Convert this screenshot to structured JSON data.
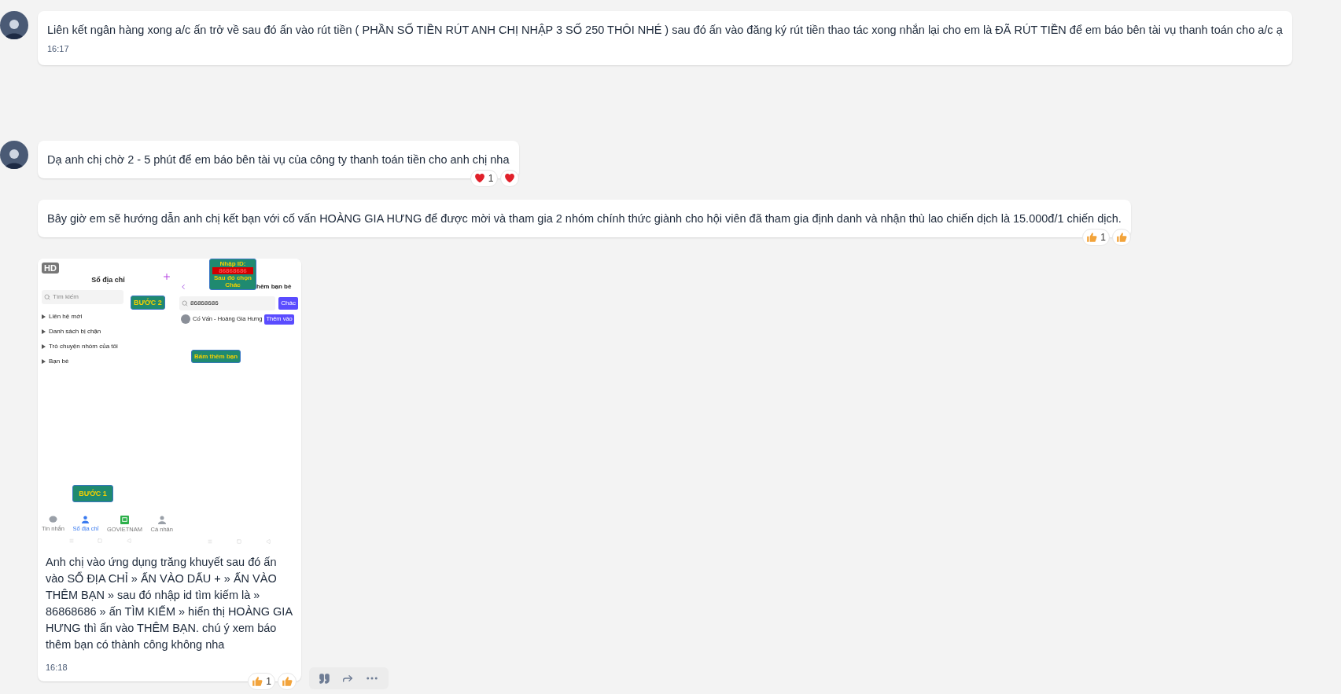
{
  "messages": [
    {
      "kind": "text",
      "avatar": true,
      "text": "Liên kết ngân hàng xong a/c ấn trở về sau đó ấn vào rút tiền ( PHẦN SỐ TIỀN RÚT ANH CHỊ NHẬP 3 SỐ 250 THÔI NHÉ ) sau đó ấn vào đăng ký rút tiền thao tác xong nhắn lại cho em là ĐÃ RÚT TIỀN để em báo bên tài vụ thanh toán cho a/c ạ",
      "time": "16:17"
    },
    {
      "kind": "text",
      "avatar": true,
      "text": "Dạ anh chị chờ 2 - 5 phút để em báo bên tài vụ của công ty thanh toán tiền cho anh chị nha",
      "reactions": [
        {
          "kind": "heart",
          "count": "1"
        },
        {
          "kind": "heart"
        }
      ]
    },
    {
      "kind": "text",
      "avatar": false,
      "text": "Bây giờ em sẽ hướng dẫn anh chị kết bạn với cố vấn HOÀNG GIA HƯNG để được mời và tham gia 2 nhóm chính thức giành cho hội viên đã tham gia định danh và nhận thù lao chiến dịch là 15.000đ/1 chiến dịch.",
      "reactions": [
        {
          "kind": "like",
          "count": "1"
        },
        {
          "kind": "like"
        }
      ]
    },
    {
      "kind": "image",
      "avatar": false,
      "text": "Anh chị vào ứng dụng trăng khuyết sau đó ấn vào SỔ ĐỊA CHỈ » ẤN VÀO DẤU + » ẤN VÀO THÊM BẠN » sau đó nhập id tìm kiếm là » 86868686  » ấn TÌM KIẾM » hiển thị HOÀNG GIA HƯNG thì ấn vào THÊM BẠN.  chú ý xem báo thêm bạn có thành công không nha",
      "time": "16:18",
      "reactions": [
        {
          "kind": "like",
          "count": "1"
        },
        {
          "kind": "like"
        }
      ],
      "shot": {
        "badge": "HD",
        "left_title": "Sổ địa chỉ",
        "search_placeholder": "Tìm kiếm",
        "tree": [
          "Liên hệ mới",
          "Danh sách bị chặn",
          "Trò chuyện nhóm của tôi",
          "Bạn bè"
        ],
        "right_title": "hêm bạn bè",
        "search_value": "86868686",
        "search_button": "Chác",
        "contact": "Cố Vấn - Hoàng Gia Hưng",
        "add_button": "Thêm vào",
        "callouts": {
          "step2": "BƯỚC 2",
          "id_label": "Nhập ID:",
          "id_value": "86868686",
          "id_then": "Sau đó chọn",
          "id_button": "Chác",
          "add": "Bấm thêm bạn",
          "step1": "BƯỚC 1"
        },
        "nav": [
          {
            "kind": "chat",
            "label": "Tin nhắn",
            "selected": false
          },
          {
            "kind": "contacts",
            "label": "Sổ địa chỉ",
            "selected": true
          },
          {
            "kind": "app",
            "label": "GOVIETNAM",
            "selected": false
          },
          {
            "kind": "person",
            "label": "Cá nhân",
            "selected": false
          }
        ]
      }
    }
  ]
}
